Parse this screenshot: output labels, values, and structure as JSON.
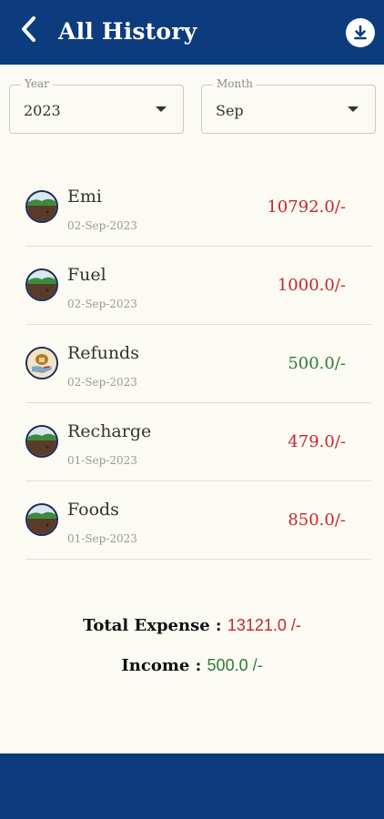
{
  "appbar": {
    "title": "All History",
    "back_icon": "chevron-left-icon",
    "download_icon": "download-icon"
  },
  "filters": {
    "year": {
      "label": "Year",
      "value": "2023"
    },
    "month": {
      "label": "Month",
      "value": "Sep"
    }
  },
  "colors": {
    "expense": "#c62828",
    "income": "#2e7d32",
    "primary": "#0c3c7d"
  },
  "transactions": [
    {
      "category": "Emi",
      "date": "02-Sep-2023",
      "amount": "10792.0/-",
      "type": "expense",
      "icon": "landscape-icon"
    },
    {
      "category": "Fuel",
      "date": "02-Sep-2023",
      "amount": "1000.0/-",
      "type": "expense",
      "icon": "landscape-icon"
    },
    {
      "category": "Refunds",
      "date": "02-Sep-2023",
      "amount": "500.0/-",
      "type": "income",
      "icon": "money-hand-icon"
    },
    {
      "category": "Recharge",
      "date": "01-Sep-2023",
      "amount": "479.0/-",
      "type": "expense",
      "icon": "landscape-icon"
    },
    {
      "category": "Foods",
      "date": "01-Sep-2023",
      "amount": "850.0/-",
      "type": "expense",
      "icon": "landscape-icon"
    }
  ],
  "summary": {
    "expense_label": "Total Expense : ",
    "expense_value": "13121.0 /-",
    "income_label": "Income : ",
    "income_value": "500.0 /-"
  }
}
